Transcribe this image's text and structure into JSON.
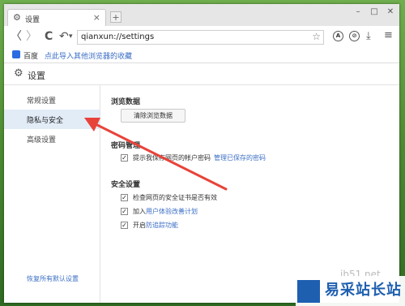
{
  "tab": {
    "title": "设置",
    "close": "×",
    "new": "+"
  },
  "window": {
    "minimize": "–",
    "maximize": "□",
    "close": "✕"
  },
  "address": {
    "url": "qianxun://settings",
    "star": "☆"
  },
  "nav": {
    "back": "〈",
    "forward": "〉",
    "reload": "C",
    "undo": "↶",
    "undo_dropdown": "▾"
  },
  "toolbar": {
    "a_label": "A",
    "o_label": "⊘",
    "download": "⤓",
    "menu": "≡"
  },
  "bookmarks": {
    "baidu": "百度",
    "import_link": "点此导入其他浏览器的收藏"
  },
  "header": {
    "title": "设置"
  },
  "sidebar": {
    "items": [
      {
        "label": "常规设置",
        "active": false
      },
      {
        "label": "隐私与安全",
        "active": true
      },
      {
        "label": "高级设置",
        "active": false
      }
    ],
    "restore": "恢复所有默认设置"
  },
  "main": {
    "browsing": {
      "title": "浏览数据",
      "clear_button": "清除浏览数据"
    },
    "passwords": {
      "title": "密码管理",
      "prompt_label": "提示我保存网页的帐户密码",
      "prompt_checked": true,
      "manage_link": "管理已保存的密码"
    },
    "security": {
      "title": "安全设置",
      "cert_label": "检查网页的安全证书是否有效",
      "cert_checked": true,
      "ux_prefix": "加入",
      "ux_link": "用户体验改善计划",
      "ux_checked": true,
      "dnt_prefix": "开启",
      "dnt_link": "防追踪功能",
      "dnt_checked": true
    }
  },
  "watermark": {
    "brand": "易采站长站",
    "site": "jb51.net"
  },
  "colors": {
    "accent": "#3b6ec5",
    "arrow": "#e8433a",
    "active_bg": "#e2ecf7"
  }
}
